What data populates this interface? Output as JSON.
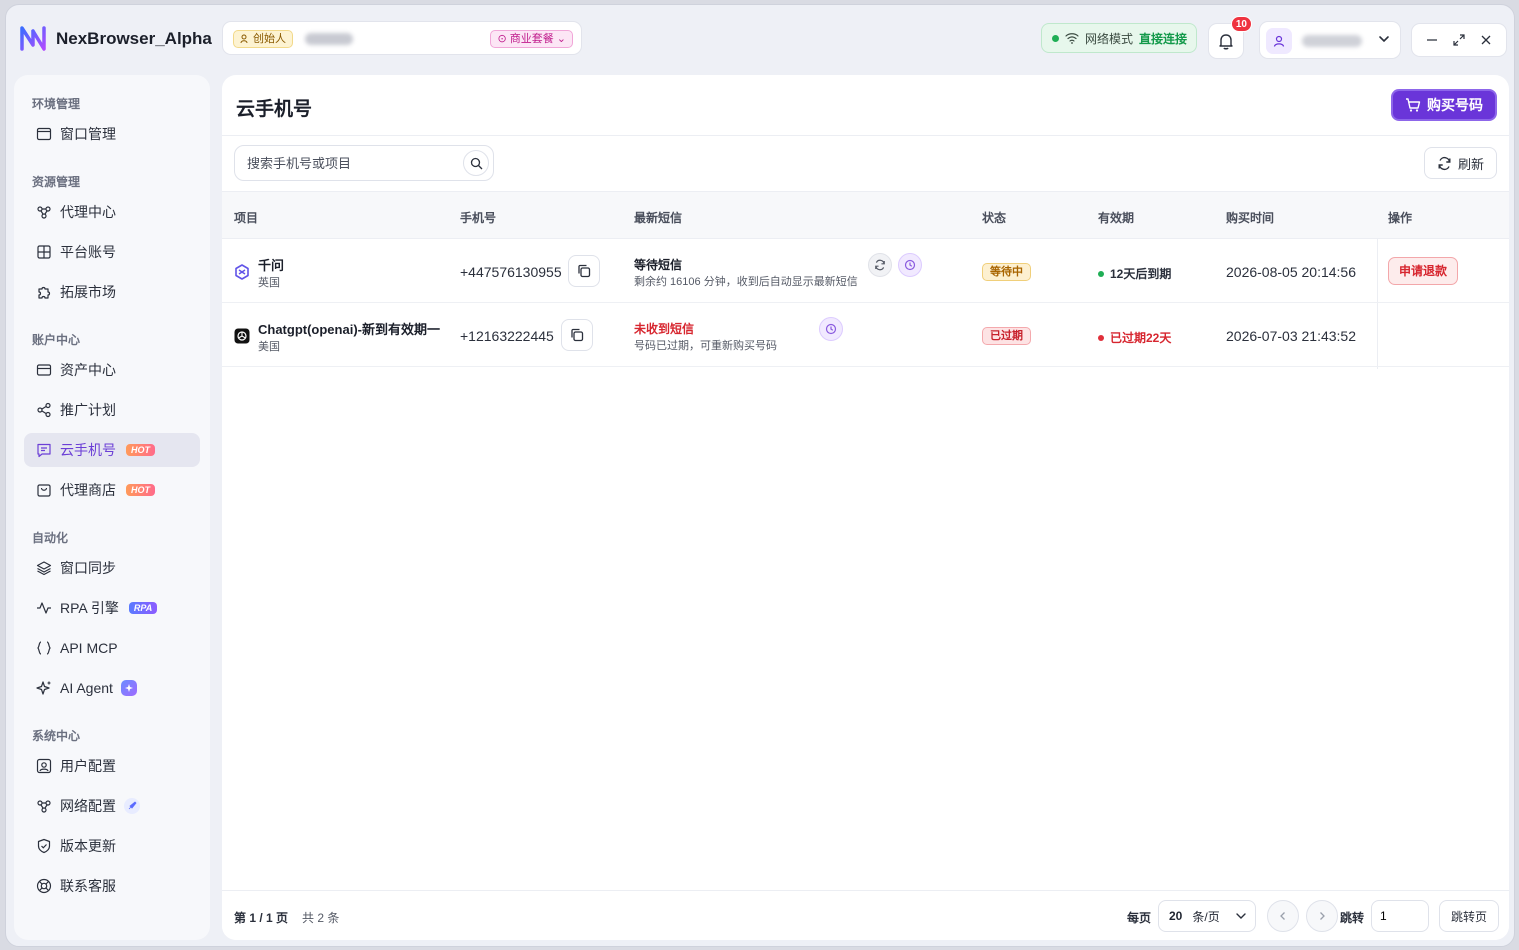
{
  "app": {
    "title": "NexBrowser_Alpha",
    "founder_label": "创始人",
    "plan_label": "商业套餐",
    "network_label": "网络模式",
    "network_status": "直接连接",
    "notification_count": "10",
    "accent_color": "#6a35d9"
  },
  "sidebar": {
    "groups": [
      {
        "label": "环境管理"
      },
      {
        "label": "资源管理"
      },
      {
        "label": "账户中心"
      },
      {
        "label": "自动化"
      },
      {
        "label": "系统中心"
      }
    ],
    "items": [
      {
        "label": "窗口管理",
        "icon": "window-icon"
      },
      {
        "label": "代理中心",
        "icon": "proxy-icon"
      },
      {
        "label": "平台账号",
        "icon": "grid-icon"
      },
      {
        "label": "拓展市场",
        "icon": "puzzle-icon"
      },
      {
        "label": "资产中心",
        "icon": "wallet-icon"
      },
      {
        "label": "推广计划",
        "icon": "share-icon"
      },
      {
        "label": "云手机号",
        "icon": "message-icon",
        "tag": "HOT",
        "active": true
      },
      {
        "label": "代理商店",
        "icon": "shop-icon",
        "tag": "HOT"
      },
      {
        "label": "窗口同步",
        "icon": "layers-icon"
      },
      {
        "label": "RPA 引擎",
        "icon": "pulse-icon",
        "tag": "RPA"
      },
      {
        "label": "API MCP",
        "icon": "braces-icon"
      },
      {
        "label": "AI Agent",
        "icon": "sparkle-icon"
      },
      {
        "label": "用户配置",
        "icon": "user-config-icon"
      },
      {
        "label": "网络配置",
        "icon": "network-icon"
      },
      {
        "label": "版本更新",
        "icon": "shield-icon"
      },
      {
        "label": "联系客服",
        "icon": "support-icon"
      }
    ]
  },
  "main": {
    "title": "云手机号",
    "buy_label": "购买号码",
    "search_placeholder": "搜索手机号或项目",
    "refresh_label": "刷新"
  },
  "table": {
    "columns": [
      "项目",
      "手机号",
      "最新短信",
      "状态",
      "有效期",
      "购买时间",
      "操作"
    ],
    "rows": [
      {
        "project": "千问",
        "country": "英国",
        "phone": "+447576130955",
        "sms_title": "等待短信",
        "sms_sub": "剩余约 16106 分钟，收到后自动显示最新短信",
        "status": "等待中",
        "validity": "12天后到期",
        "purchase_time": "2026-08-05 20:14:56",
        "action": "申请退款"
      },
      {
        "project": "Chatgpt(openai)-新到有效期一",
        "country": "美国",
        "phone": "+12163222445",
        "sms_title": "未收到短信",
        "sms_sub": "号码已过期，可重新购买号码",
        "status": "已过期",
        "validity": "已过期22天",
        "purchase_time": "2026-07-03 21:43:52",
        "action": ""
      }
    ]
  },
  "footer": {
    "page_info": "第 1 / 1 页",
    "total": "共 2 条",
    "per_page_label": "每页",
    "per_page_value": "20",
    "per_page_unit": "条/页",
    "jump_label": "跳转",
    "jump_value": "1",
    "jump_button": "跳转页"
  }
}
